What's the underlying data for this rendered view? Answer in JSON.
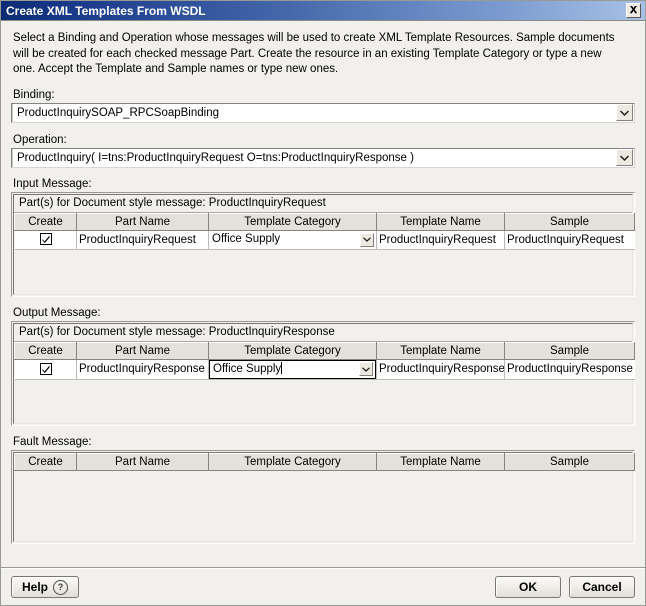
{
  "window": {
    "title": "Create XML Templates From WSDL",
    "close_icon": "close-icon"
  },
  "intro": {
    "text": "Select a Binding and Operation whose messages will be used to create XML Template Resources.  Sample documents will be created for each checked message Part. Create the resource in an existing Template Category or type a new one. Accept the Template and Sample names or type new ones."
  },
  "binding": {
    "label": "Binding:",
    "value": "ProductInquirySOAP_RPCSoapBinding",
    "dropdown_icon": "chevron-down-icon"
  },
  "operation": {
    "label": "Operation:",
    "value": "ProductInquiry( I=tns:ProductInquiryRequest O=tns:ProductInquiryResponse )",
    "dropdown_icon": "chevron-down-icon"
  },
  "columns": [
    "Create",
    "Part Name",
    "Template Category",
    "Template Name",
    "Sample"
  ],
  "input_message": {
    "label": "Input Message:",
    "caption": "Part(s) for Document style message: ProductInquiryRequest",
    "rows": [
      {
        "create": true,
        "part_name": "ProductInquiryRequest",
        "template_category": "Office Supply",
        "template_category_editing": false,
        "template_name": "ProductInquiryRequest",
        "sample": "ProductInquiryRequest"
      }
    ]
  },
  "output_message": {
    "label": "Output Message:",
    "caption": "Part(s) for Document style message: ProductInquiryResponse",
    "rows": [
      {
        "create": true,
        "part_name": "ProductInquiryResponse",
        "template_category": "Office Supply",
        "template_category_editing": true,
        "template_name": "ProductInquiryResponse",
        "sample": "ProductInquiryResponse"
      }
    ]
  },
  "fault_message": {
    "label": "Fault Message:",
    "rows": []
  },
  "footer": {
    "help_label": "Help",
    "help_icon": "question-circle-icon",
    "ok_label": "OK",
    "cancel_label": "Cancel"
  },
  "colors": {
    "title_bar_start": "#0a2a72",
    "title_bar_end": "#a8c2e6",
    "dialog_background": "#f1f0ed",
    "field_background": "#ffffff",
    "header_background": "#e4e1da"
  }
}
